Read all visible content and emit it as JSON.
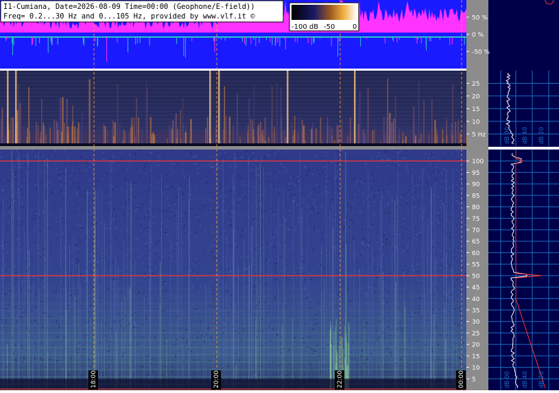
{
  "header": {
    "line1": "I1-Cumiana, Date=2026-08-09 Time=00:00 (Geophone/E-field))",
    "line2": "Freq= 0.2...30 Hz and 0...105 Hz, provided by www.vlf.it ©"
  },
  "colorbar": {
    "labels": [
      "-100 dB",
      "-50",
      "0"
    ]
  },
  "colors": {
    "magenta": "#ff33ff",
    "blue": "#1a1aff",
    "spectro_dark": "#1b1f52",
    "spectro_mid": "#3a4a9a",
    "panel_bg": "#000048",
    "grid": "#1d6ec4",
    "gutter": "#8c8c8c",
    "cursor": "#ff9933",
    "hum_line": "#ff3333"
  },
  "chart_data": [
    {
      "type": "line",
      "panel": "amplitude",
      "yunit": "%",
      "yticks": [
        50,
        0,
        -50
      ],
      "yticklabels": [
        "50 %",
        "0 %",
        "-50 %"
      ],
      "ylim": [
        -100,
        100
      ]
    },
    {
      "type": "heatmap",
      "panel": "spectrogram-low",
      "yunit": "Hz",
      "yticks": [
        25,
        20,
        15,
        10,
        5
      ],
      "yticklabels": [
        "25",
        "20",
        "15",
        "10",
        "5 Hz"
      ],
      "ylim": [
        0.2,
        30
      ]
    },
    {
      "type": "heatmap",
      "panel": "spectrogram-high",
      "yticks": [
        100,
        95,
        90,
        85,
        80,
        75,
        70,
        65,
        60,
        55,
        50,
        45,
        40,
        35,
        30,
        25,
        20,
        15,
        10,
        5
      ],
      "yticklabels": [
        "100",
        "95",
        "90",
        "85",
        "80",
        "75",
        "70",
        "65",
        "60",
        "55",
        "50",
        "45",
        "40",
        "35",
        "30",
        "25",
        "20",
        "15",
        "10",
        "5"
      ],
      "ylim": [
        0,
        105
      ],
      "hum_lines_hz": [
        50,
        100
      ]
    },
    {
      "type": "line",
      "panel": "time-axis",
      "xticks": [
        "18:00",
        "20:00",
        "22:00",
        "00:00"
      ]
    },
    {
      "type": "line",
      "panel": "spectrum-low",
      "xticklabels": [
        "dB 00",
        "dB 40",
        "dB 20"
      ]
    },
    {
      "type": "line",
      "panel": "spectrum-high",
      "xticklabels": [
        "dB 00",
        "dB 40",
        "dB 20"
      ]
    }
  ]
}
